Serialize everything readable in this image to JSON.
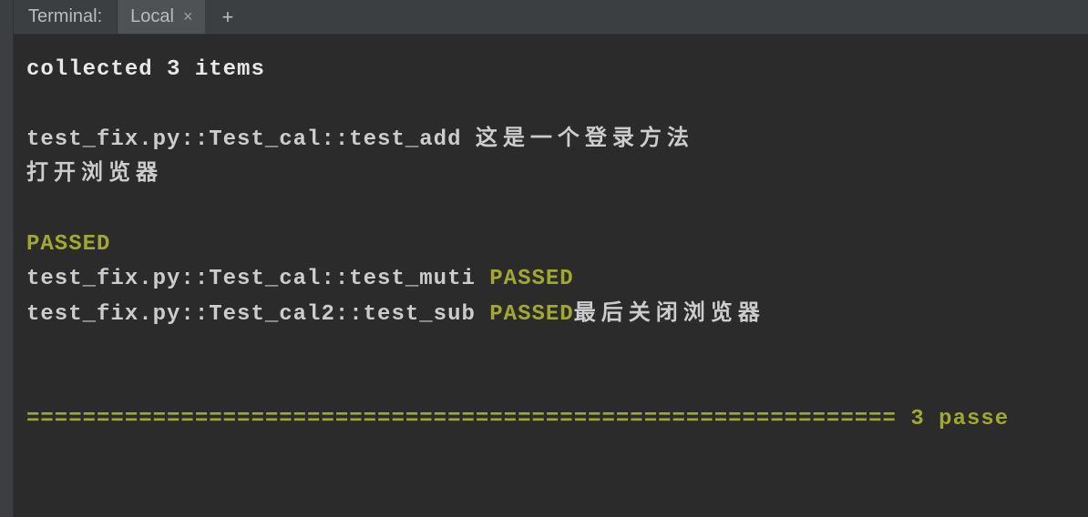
{
  "panel": {
    "title": "Terminal:",
    "tab_label": "Local"
  },
  "output": {
    "collected": "collected 3 items",
    "line1_path": "test_fix.py::Test_cal::test_add ",
    "line1_cjk": "这是一个登录方法",
    "line2_cjk": "打开浏览器",
    "passed": "PASSED",
    "line3_path": "test_fix.py::Test_cal::test_muti ",
    "line4_path": "test_fix.py::Test_cal2::test_sub ",
    "line4_cjk": "最后关闭浏览器",
    "summary_sep": "==============================================================",
    "summary_text": " 3 passe"
  },
  "colors": {
    "pass_green": "#a0a82f",
    "text": "#cccccc",
    "bg": "#2b2b2b"
  }
}
